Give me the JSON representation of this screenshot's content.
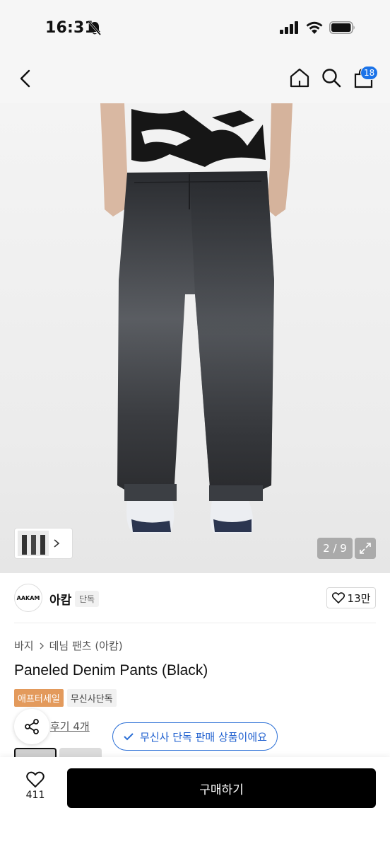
{
  "status_bar": {
    "time": "16:31"
  },
  "nav": {
    "cart_count": "18"
  },
  "gallery": {
    "page_indicator": "2 / 9"
  },
  "brand": {
    "logo_text": "AAKAM",
    "name": "아캄",
    "tag": "단독",
    "likes": "13만"
  },
  "breadcrumb": {
    "category": "바지",
    "subcategory": "데님 팬츠 (아캄)"
  },
  "product": {
    "title": "Paneled Denim Pants (Black)",
    "badges": [
      "애프터세일",
      "무신사단독"
    ]
  },
  "reviews": {
    "link_text": "후기 4개"
  },
  "notice": {
    "exclusive_text": "무신사 단독 판매 상품이에요"
  },
  "bottom_bar": {
    "like_count": "411",
    "buy_label": "구매하기"
  },
  "colors": {
    "accent_blue": "#2b6fd6",
    "badge_blue": "#1b73e8",
    "sale_orange": "#e39a5c",
    "buy_black": "#000000"
  }
}
